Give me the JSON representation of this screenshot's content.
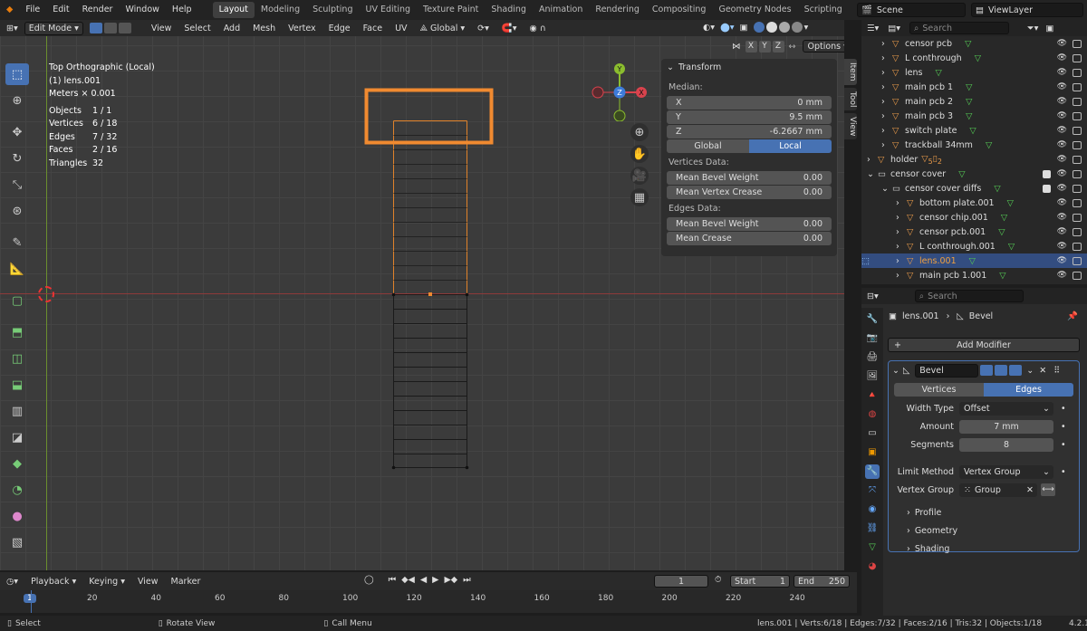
{
  "topbar": {
    "menus": [
      "File",
      "Edit",
      "Render",
      "Window",
      "Help"
    ],
    "workspaces": [
      "Layout",
      "Modeling",
      "Sculpting",
      "UV Editing",
      "Texture Paint",
      "Shading",
      "Animation",
      "Rendering",
      "Compositing",
      "Geometry Nodes",
      "Scripting"
    ],
    "active_workspace": "Layout",
    "scene": "Scene",
    "view_layer": "ViewLayer"
  },
  "viewport": {
    "mode": "Edit Mode",
    "menus": [
      "View",
      "Select",
      "Add",
      "Mesh",
      "Vertex",
      "Edge",
      "Face",
      "UV"
    ],
    "orientation": "Global",
    "axes": [
      "X",
      "Y",
      "Z"
    ],
    "options": "Options",
    "overlay": {
      "view_name": "Top Orthographic (Local)",
      "object": "(1) lens.001",
      "scale": "Meters × 0.001",
      "stats": [
        {
          "label": "Objects",
          "value": "1 / 1"
        },
        {
          "label": "Vertices",
          "value": "6 / 18"
        },
        {
          "label": "Edges",
          "value": "7 / 32"
        },
        {
          "label": "Faces",
          "value": "2 / 16"
        },
        {
          "label": "Triangles",
          "value": "32"
        }
      ]
    },
    "gizmo": {
      "y": "Y",
      "z": "Z",
      "x": "X"
    }
  },
  "npanel": {
    "title": "Transform",
    "median_label": "Median:",
    "x": {
      "label": "X",
      "value": "0 mm"
    },
    "y": {
      "label": "Y",
      "value": "9.5 mm"
    },
    "z": {
      "label": "Z",
      "value": "-6.2667 mm"
    },
    "global_label": "Global",
    "local_label": "Local",
    "vertices_data": "Vertices Data:",
    "mean_bevel_weight_v": {
      "label": "Mean Bevel Weight",
      "value": "0.00"
    },
    "mean_vertex_crease": {
      "label": "Mean Vertex Crease",
      "value": "0.00"
    },
    "edges_data": "Edges Data:",
    "mean_bevel_weight_e": {
      "label": "Mean Bevel Weight",
      "value": "0.00"
    },
    "mean_crease": {
      "label": "Mean Crease",
      "value": "0.00"
    },
    "tabs": [
      "Item",
      "Tool",
      "View"
    ]
  },
  "outliner": {
    "search_placeholder": "Search",
    "rows": [
      {
        "name": "censor pcb",
        "indent": 1,
        "type": "obj"
      },
      {
        "name": "L conthrough",
        "indent": 1,
        "type": "obj"
      },
      {
        "name": "lens",
        "indent": 1,
        "type": "obj"
      },
      {
        "name": "main pcb 1",
        "indent": 1,
        "type": "obj"
      },
      {
        "name": "main pcb 2",
        "indent": 1,
        "type": "obj"
      },
      {
        "name": "main pcb 3",
        "indent": 1,
        "type": "obj"
      },
      {
        "name": "switch plate",
        "indent": 1,
        "type": "obj"
      },
      {
        "name": "trackball 34mm",
        "indent": 1,
        "type": "obj"
      },
      {
        "name": "holder",
        "indent": 0,
        "type": "obj",
        "badge": "5",
        "badge2": "2"
      },
      {
        "name": "censor cover",
        "indent": 0,
        "type": "coll"
      },
      {
        "name": "censor cover diffs",
        "indent": 1,
        "type": "coll"
      },
      {
        "name": "bottom plate.001",
        "indent": 2,
        "type": "obj"
      },
      {
        "name": "censor chip.001",
        "indent": 2,
        "type": "obj"
      },
      {
        "name": "censor pcb.001",
        "indent": 2,
        "type": "obj"
      },
      {
        "name": "L conthrough.001",
        "indent": 2,
        "type": "obj"
      },
      {
        "name": "lens.001",
        "indent": 2,
        "type": "obj",
        "selected": true
      },
      {
        "name": "main pcb 1.001",
        "indent": 2,
        "type": "obj"
      }
    ]
  },
  "properties": {
    "search_placeholder": "Search",
    "object": "lens.001",
    "modifier_name": "Bevel",
    "add_modifier": "Add Modifier",
    "bevel_name": "Bevel",
    "affect_vertices": "Vertices",
    "affect_edges": "Edges",
    "width_type": {
      "label": "Width Type",
      "value": "Offset"
    },
    "amount": {
      "label": "Amount",
      "value": "7 mm"
    },
    "segments": {
      "label": "Segments",
      "value": "8"
    },
    "limit_method": {
      "label": "Limit Method",
      "value": "Vertex Group"
    },
    "vertex_group": {
      "label": "Vertex Group",
      "value": "Group"
    },
    "subpanels": [
      "Profile",
      "Geometry",
      "Shading"
    ]
  },
  "timeline": {
    "menus": [
      "Playback",
      "Keying",
      "View",
      "Marker"
    ],
    "current_frame": "1",
    "start_label": "Start",
    "start": "1",
    "end_label": "End",
    "end": "250",
    "ticks": [
      "1",
      "20",
      "40",
      "60",
      "80",
      "100",
      "120",
      "140",
      "160",
      "180",
      "200",
      "220",
      "240"
    ]
  },
  "status": {
    "select": "Select",
    "rotate": "Rotate View",
    "call_menu": "Call Menu",
    "info": "lens.001 | Verts:6/18 | Edges:7/32 | Faces:2/16 | Tris:32 | Objects:1/18",
    "version": "4.2.1"
  },
  "colors": {
    "accent": "#4772b3",
    "selection": "#f08a30",
    "highlight": "#e8802a"
  }
}
